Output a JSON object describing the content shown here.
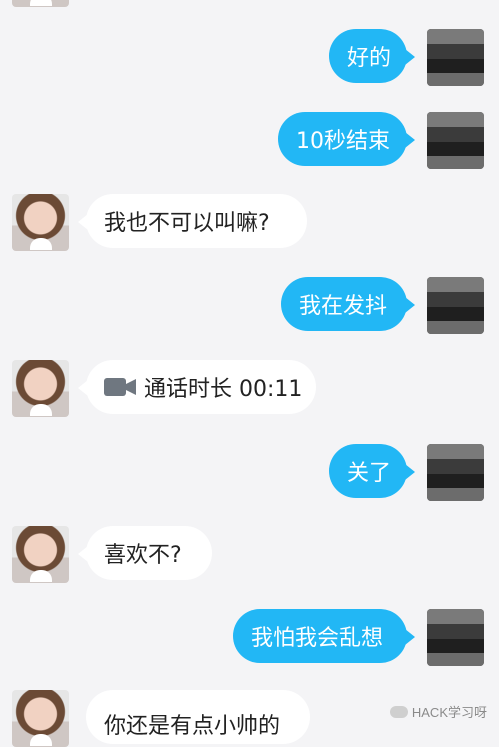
{
  "messages": [
    {
      "id": 1,
      "from": "me",
      "text": "好的"
    },
    {
      "id": 2,
      "from": "me",
      "text": "10秒结束"
    },
    {
      "id": 3,
      "from": "them",
      "text": "我也不可以叫嘛?"
    },
    {
      "id": 4,
      "from": "me",
      "text": "我在发抖"
    },
    {
      "id": 5,
      "from": "them",
      "type": "video_call",
      "text": "通话时长 00:11"
    },
    {
      "id": 6,
      "from": "me",
      "text": "关了"
    },
    {
      "id": 7,
      "from": "them",
      "text": "喜欢不?"
    },
    {
      "id": 8,
      "from": "me",
      "text": "我怕我会乱想"
    },
    {
      "id": 9,
      "from": "them",
      "text": "你还是有点小帅的"
    }
  ],
  "watermark": {
    "text": "HACK学习呀"
  },
  "colors": {
    "background": "#f4f4f6",
    "my_bubble": "#22b7f5",
    "their_bubble": "#ffffff",
    "text_dark": "#222222",
    "text_light": "#ffffff",
    "video_icon": "#6f7780"
  }
}
